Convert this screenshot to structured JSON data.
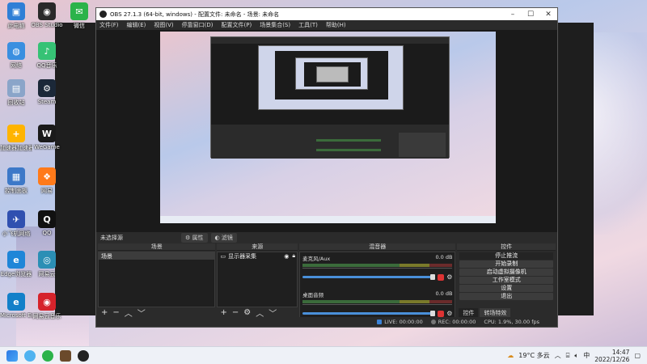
{
  "desktop": {
    "icons": [
      {
        "label": "此电脑",
        "color": "#2f7fd6",
        "glyph": "▣"
      },
      {
        "label": "OBS Studio",
        "color": "#2a2a2a",
        "glyph": "◉"
      },
      {
        "label": "微信",
        "color": "#2bb34a",
        "glyph": "✉"
      },
      {
        "label": "网络",
        "color": "#3a8fe0",
        "glyph": "◍"
      },
      {
        "label": "QQ音乐",
        "color": "#36c275",
        "glyph": "♪"
      },
      {
        "label": "回收站",
        "color": "#8aa5c9",
        "glyph": "▤"
      },
      {
        "label": "Steam",
        "color": "#1b2838",
        "glyph": "⚙"
      },
      {
        "label": "加速器加速器",
        "color": "#ffb400",
        "glyph": "+"
      },
      {
        "label": "WeGame",
        "color": "#1a1a1a",
        "glyph": "W"
      },
      {
        "label": "控制面板",
        "color": "#3c78c8",
        "glyph": "▦"
      },
      {
        "label": "网易",
        "color": "#ff7a1a",
        "glyph": "❖"
      },
      {
        "label": "小飞机网络",
        "color": "#3050b0",
        "glyph": "✈"
      },
      {
        "label": "QQ",
        "color": "#111",
        "glyph": "Q"
      },
      {
        "label": "Edge浏览器",
        "color": "#1f86d8",
        "glyph": "e"
      },
      {
        "label": "网易云",
        "color": "#2b8fb5",
        "glyph": "◎"
      },
      {
        "label": "Microsoft Edge",
        "color": "#1380c9",
        "glyph": "e"
      },
      {
        "label": "网易云音乐",
        "color": "#d6232b",
        "glyph": "◉"
      }
    ]
  },
  "obs": {
    "title": "OBS 27.1.3 (64-bit, windows) - 配置文件: 未命名 - 场景: 未命名",
    "menu": [
      "文件(F)",
      "编辑(E)",
      "视图(V)",
      "停靠窗口(D)",
      "配置文件(P)",
      "场景集合(S)",
      "工具(T)",
      "帮助(H)"
    ],
    "current_scene_label": "未选择源",
    "properties_button": "属性",
    "filters_button": "滤镜",
    "docks": {
      "scenes": {
        "header": "场景",
        "items": [
          "场景"
        ]
      },
      "sources": {
        "header": "来源",
        "items": [
          "显示器采集"
        ]
      },
      "mixer": {
        "header": "混音器",
        "channels": [
          {
            "name": "麦克风/Aux",
            "db": "0.0 dB",
            "volume": 1.0
          },
          {
            "name": "桌面音频",
            "db": "0.0 dB",
            "volume": 1.0
          }
        ]
      },
      "controls": {
        "header": "控件",
        "buttons": [
          "停止推流",
          "开始录制",
          "启动虚拟摄像机",
          "工作室模式",
          "设置",
          "退出"
        ],
        "tabs": [
          "控件",
          "转场特效"
        ]
      }
    },
    "status": {
      "live": "LIVE: 00:00:00",
      "rec": "REC: 00:00:00",
      "cpu": "CPU: 1.9%, 30.00 fps"
    }
  },
  "taskbar": {
    "weather": "19°C 多云",
    "time": "14:47",
    "date": "2022/12/26"
  }
}
